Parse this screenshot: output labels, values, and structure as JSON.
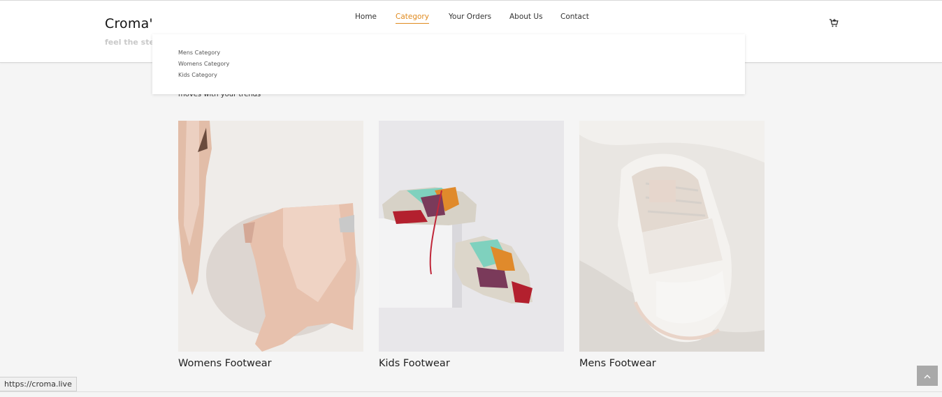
{
  "brand": {
    "name": "Croma'",
    "tagline": "feel the step"
  },
  "nav": {
    "items": [
      {
        "label": "Home",
        "active": false
      },
      {
        "label": "Category",
        "active": true
      },
      {
        "label": "Your Orders",
        "active": false
      },
      {
        "label": "About Us",
        "active": false
      },
      {
        "label": "Contact",
        "active": false
      }
    ],
    "cart_icon": "cart-icon"
  },
  "dropdown": {
    "items": [
      "Mens Category",
      "Womens Category",
      "Kids Category"
    ]
  },
  "section": {
    "subtext": "moves with your trends"
  },
  "products": [
    {
      "title": "Womens Footwear",
      "image": "womens-boot-image"
    },
    {
      "title": "Kids Footwear",
      "image": "kids-sneakers-image"
    },
    {
      "title": "Mens Footwear",
      "image": "mens-sneaker-image"
    }
  ],
  "status_bar": {
    "url": "https://croma.live"
  },
  "colors": {
    "accent": "#e08a1e",
    "background": "#f5f5f5"
  }
}
